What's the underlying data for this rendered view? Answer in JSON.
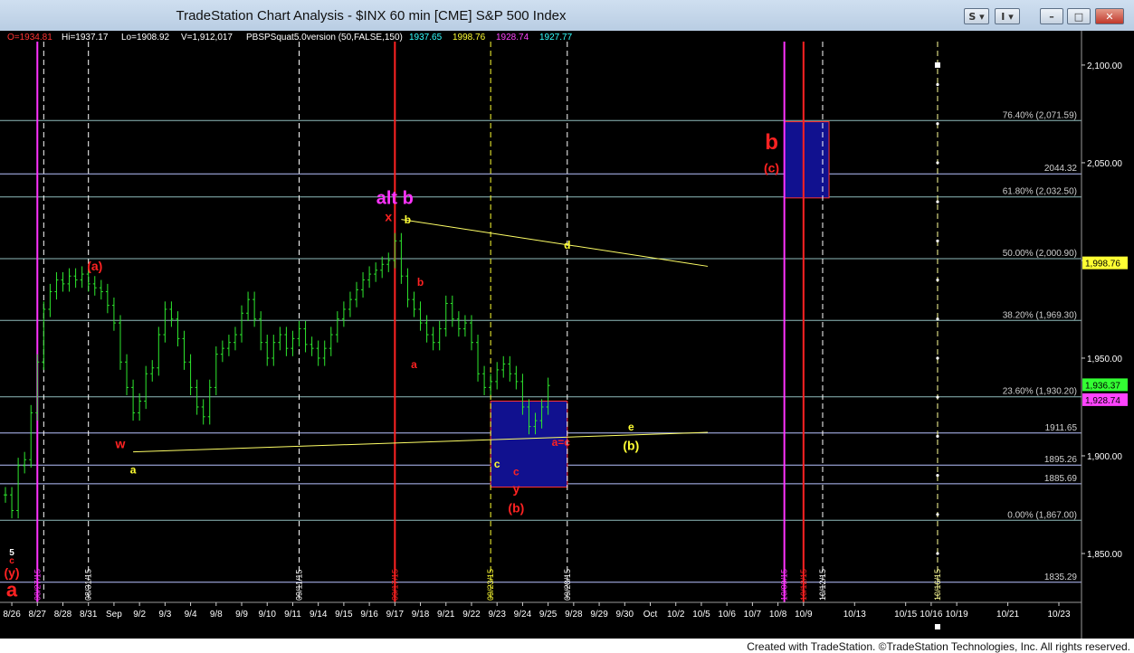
{
  "window": {
    "title": "TradeStation Chart Analysis - $INX 60 min [CME] S&P 500 Index",
    "buttons": [
      "S",
      "I",
      "–",
      "□",
      "✕"
    ]
  },
  "header": {
    "ohlc": [
      {
        "text": "O=1934.81",
        "color": "#ff3333"
      },
      {
        "text": "Hi=1937.17",
        "color": "#ffffff"
      },
      {
        "text": "Lo=1908.92",
        "color": "#ffffff"
      },
      {
        "text": "V=1,912,017",
        "color": "#ffffff"
      },
      {
        "text": "PBSPSquat5.0version (50,FALSE,150)",
        "color": "#ffffff"
      }
    ],
    "indicator_values": [
      {
        "text": "1937.65",
        "color": "#33ffff"
      },
      {
        "text": "1998.76",
        "color": "#ffff33"
      },
      {
        "text": "1928.74",
        "color": "#ff44ff"
      },
      {
        "text": "1927.77",
        "color": "#33ffff"
      }
    ]
  },
  "chart_data": {
    "type": "candlestick",
    "title": "TradeStation Chart Analysis - $INX 60 min [CME] S&P 500 Index",
    "symbol": "$INX",
    "interval": "60 min",
    "ylim": [
      1825,
      2112
    ],
    "x_range_index": [
      0,
      165
    ],
    "y_ticks": [
      1850.0,
      1900.0,
      1950.0,
      2000.0,
      2050.0,
      2100.0
    ],
    "y_tick_labels": [
      "1,850.00",
      "1,900.00",
      "1,950.00",
      "2,000.00",
      "2,050.00",
      "2,100.00"
    ],
    "x_tick_labels": [
      {
        "label": "8/26",
        "i": 1
      },
      {
        "label": "8/27",
        "i": 5
      },
      {
        "label": "8/28",
        "i": 9
      },
      {
        "label": "8/31",
        "i": 13
      },
      {
        "label": "Sep",
        "i": 17
      },
      {
        "label": "9/2",
        "i": 21
      },
      {
        "label": "9/3",
        "i": 25
      },
      {
        "label": "9/4",
        "i": 29
      },
      {
        "label": "9/8",
        "i": 33
      },
      {
        "label": "9/9",
        "i": 37
      },
      {
        "label": "9/10",
        "i": 41
      },
      {
        "label": "9/11",
        "i": 45
      },
      {
        "label": "9/14",
        "i": 49
      },
      {
        "label": "9/15",
        "i": 53
      },
      {
        "label": "9/16",
        "i": 57
      },
      {
        "label": "9/17",
        "i": 61
      },
      {
        "label": "9/18",
        "i": 65
      },
      {
        "label": "9/21",
        "i": 69
      },
      {
        "label": "9/22",
        "i": 73
      },
      {
        "label": "9/23",
        "i": 77
      },
      {
        "label": "9/24",
        "i": 81
      },
      {
        "label": "9/25",
        "i": 85
      },
      {
        "label": "9/28",
        "i": 89
      },
      {
        "label": "9/29",
        "i": 93
      },
      {
        "label": "9/30",
        "i": 97
      },
      {
        "label": "Oct",
        "i": 101
      },
      {
        "label": "10/2",
        "i": 105
      },
      {
        "label": "10/5",
        "i": 109
      },
      {
        "label": "10/6",
        "i": 113
      },
      {
        "label": "10/7",
        "i": 117
      },
      {
        "label": "10/8",
        "i": 121
      },
      {
        "label": "10/9",
        "i": 125
      },
      {
        "label": "10/13",
        "i": 133
      },
      {
        "label": "10/15",
        "i": 141
      },
      {
        "label": "10/16",
        "i": 145
      },
      {
        "label": "10/19",
        "i": 149
      },
      {
        "label": "10/21",
        "i": 157
      },
      {
        "label": "10/23",
        "i": 165
      }
    ],
    "close_path": [
      [
        0,
        1880
      ],
      [
        1,
        1872
      ],
      [
        2,
        1895
      ],
      [
        3,
        1898
      ],
      [
        4,
        1922
      ],
      [
        5,
        1948
      ],
      [
        6,
        1975
      ],
      [
        7,
        1984
      ],
      [
        8,
        1990
      ],
      [
        9,
        1988
      ],
      [
        10,
        1992
      ],
      [
        11,
        1990
      ],
      [
        12,
        1993
      ],
      [
        13,
        1988
      ],
      [
        14,
        1986
      ],
      [
        15,
        1984
      ],
      [
        16,
        1977
      ],
      [
        17,
        1968
      ],
      [
        18,
        1948
      ],
      [
        19,
        1935
      ],
      [
        20,
        1922
      ],
      [
        21,
        1928
      ],
      [
        22,
        1942
      ],
      [
        23,
        1945
      ],
      [
        24,
        1962
      ],
      [
        25,
        1975
      ],
      [
        26,
        1970
      ],
      [
        27,
        1960
      ],
      [
        28,
        1948
      ],
      [
        29,
        1935
      ],
      [
        30,
        1925
      ],
      [
        31,
        1920
      ],
      [
        32,
        1935
      ],
      [
        33,
        1952
      ],
      [
        34,
        1955
      ],
      [
        35,
        1958
      ],
      [
        36,
        1962
      ],
      [
        37,
        1973
      ],
      [
        38,
        1980
      ],
      [
        39,
        1970
      ],
      [
        40,
        1958
      ],
      [
        41,
        1950
      ],
      [
        42,
        1958
      ],
      [
        43,
        1962
      ],
      [
        44,
        1955
      ],
      [
        45,
        1960
      ],
      [
        46,
        1965
      ],
      [
        47,
        1957
      ],
      [
        48,
        1955
      ],
      [
        49,
        1950
      ],
      [
        50,
        1955
      ],
      [
        51,
        1962
      ],
      [
        52,
        1970
      ],
      [
        53,
        1975
      ],
      [
        54,
        1980
      ],
      [
        55,
        1985
      ],
      [
        56,
        1990
      ],
      [
        57,
        1993
      ],
      [
        58,
        1995
      ],
      [
        59,
        1998
      ],
      [
        60,
        2000
      ],
      [
        61,
        2010
      ],
      [
        62,
        1992
      ],
      [
        63,
        1980
      ],
      [
        64,
        1975
      ],
      [
        65,
        1968
      ],
      [
        66,
        1962
      ],
      [
        67,
        1958
      ],
      [
        68,
        1965
      ],
      [
        69,
        1978
      ],
      [
        70,
        1970
      ],
      [
        71,
        1965
      ],
      [
        72,
        1968
      ],
      [
        73,
        1958
      ],
      [
        74,
        1942
      ],
      [
        75,
        1935
      ],
      [
        76,
        1938
      ],
      [
        77,
        1944
      ],
      [
        78,
        1947
      ],
      [
        79,
        1942
      ],
      [
        80,
        1938
      ],
      [
        81,
        1925
      ],
      [
        82,
        1915
      ],
      [
        83,
        1918
      ],
      [
        84,
        1925
      ],
      [
        85,
        1936
      ]
    ],
    "annotations": {
      "red_wave_labels": [
        {
          "text": "(a)",
          "i": 14,
          "y": 1995,
          "color": "#ff2222",
          "size": 14
        },
        {
          "text": "x",
          "i": 60,
          "y": 2020,
          "color": "#ff2222",
          "size": 14
        },
        {
          "text": "b",
          "i": 65,
          "y": 1987,
          "color": "#ff2222",
          "size": 12
        },
        {
          "text": "a",
          "i": 64,
          "y": 1945,
          "color": "#ff2222",
          "size": 12
        },
        {
          "text": "w",
          "i": 18,
          "y": 1904,
          "color": "#ff2222",
          "size": 14
        },
        {
          "text": "c",
          "i": 80,
          "y": 1890,
          "color": "#ff2222",
          "size": 12
        },
        {
          "text": "y",
          "i": 80,
          "y": 1881,
          "color": "#ff2222",
          "size": 14
        },
        {
          "text": "(b)",
          "i": 80,
          "y": 1871,
          "color": "#ff2222",
          "size": 14
        },
        {
          "text": "a=c",
          "i": 87,
          "y": 1905,
          "color": "#ff2222",
          "size": 12
        },
        {
          "text": "(c)",
          "i": 120,
          "y": 2045,
          "color": "#ff2222",
          "size": 14
        },
        {
          "text": "b",
          "i": 120,
          "y": 2057,
          "color": "#ff2222",
          "size": 24
        },
        {
          "text": "5",
          "i": 1,
          "y": 1849,
          "color": "#ffffff",
          "size": 10
        },
        {
          "text": "c",
          "i": 1,
          "y": 1845,
          "color": "#ff2222",
          "size": 10
        },
        {
          "text": "(y)",
          "i": 1,
          "y": 1838,
          "color": "#ff2222",
          "size": 14
        },
        {
          "text": "a",
          "i": 1,
          "y": 1828,
          "color": "#ff2222",
          "size": 22
        }
      ],
      "yellow_wave_labels": [
        {
          "text": "b",
          "i": 63,
          "y": 2019,
          "color": "#ffff33",
          "size": 12
        },
        {
          "text": "d",
          "i": 88,
          "y": 2006,
          "color": "#ffff33",
          "size": 12
        },
        {
          "text": "a",
          "i": 20,
          "y": 1891,
          "color": "#ffff33",
          "size": 12
        },
        {
          "text": "c",
          "i": 77,
          "y": 1894,
          "color": "#ffff33",
          "size": 12
        },
        {
          "text": "e",
          "i": 98,
          "y": 1913,
          "color": "#ffff33",
          "size": 12
        },
        {
          "text": "(b)",
          "i": 98,
          "y": 1903,
          "color": "#ffff33",
          "size": 14
        }
      ],
      "magenta_labels": [
        {
          "text": "alt b",
          "i": 61,
          "y": 2029,
          "color": "#ff33ff",
          "size": 20
        }
      ],
      "fib_levels": [
        {
          "label": "76.40% (2,071.59)",
          "y": 2071.59
        },
        {
          "label": "61.80% (2,032.50)",
          "y": 2032.5
        },
        {
          "label": "50.00% (2,000.90)",
          "y": 2000.9
        },
        {
          "label": "38.20% (1,969.30)",
          "y": 1969.3
        },
        {
          "label": "23.60% (1,930.20)",
          "y": 1930.2
        },
        {
          "label": "0.00% (1,867.00)",
          "y": 1867.0
        }
      ],
      "price_lines": [
        {
          "label": "2044.32",
          "y": 2044.32
        },
        {
          "label": "1911.65",
          "y": 1911.65
        },
        {
          "label": "1895.26",
          "y": 1895.26
        },
        {
          "label": "1885.69",
          "y": 1885.69
        },
        {
          "label": "1835.29",
          "y": 1835.29
        }
      ],
      "right_markers": [
        {
          "label": "1,998.76",
          "y": 1998.76,
          "bg": "#ffff33",
          "color": "#000000"
        },
        {
          "label": "1,936.37",
          "y": 1936.37,
          "bg": "#33ff33",
          "color": "#000000"
        },
        {
          "label": "1,928.74",
          "y": 1928.74,
          "bg": "#ff44ff",
          "color": "#000000"
        }
      ],
      "vertical_date_lines": [
        {
          "label": "08/27/15",
          "i": 5,
          "color": "#ff33ff",
          "style": "solid"
        },
        {
          "label": "08/31/15",
          "i": 13,
          "color": "#ffffff",
          "style": "dash"
        },
        {
          "label": "09/11/15",
          "i": 46,
          "color": "#ffffff",
          "style": "dash"
        },
        {
          "label": "09/17/15",
          "i": 61,
          "color": "#ff2222",
          "style": "solid"
        },
        {
          "label": "09/23/15",
          "i": 76,
          "color": "#ffff33",
          "style": "dash"
        },
        {
          "label": "09/28/15",
          "i": 88,
          "color": "#ffffff",
          "style": "dash"
        },
        {
          "label": "10/09/15",
          "i": 122,
          "color": "#ff33ff",
          "style": "solid"
        },
        {
          "label": "10/12/15",
          "i": 125,
          "color": "#ff2222",
          "style": "solid"
        },
        {
          "label": "10/12/15",
          "i": 128,
          "color": "#ffffff",
          "style": "dash"
        },
        {
          "label": "10/16/15",
          "i": 146,
          "color": "#ffff99",
          "style": "dash"
        }
      ],
      "extra_dashed_lines": [
        {
          "i": 6
        }
      ],
      "boxes": [
        {
          "i0": 76,
          "i1": 88,
          "y0": 1884,
          "y1": 1928,
          "fill": "#11118f",
          "stroke": "#ff3333"
        },
        {
          "i0": 122,
          "i1": 129,
          "y0": 2032,
          "y1": 2071,
          "fill": "#11118f",
          "stroke": "#ff3333"
        }
      ],
      "trendlines": [
        {
          "i0": 62,
          "y0": 2021,
          "i1": 110,
          "y1": 1997,
          "color": "#ffff66"
        },
        {
          "i0": 20,
          "y0": 1902,
          "i1": 110,
          "y1": 1912,
          "color": "#ffff66"
        }
      ]
    }
  },
  "footer": {
    "text": "Created with TradeStation. ©TradeStation Technologies, Inc. All rights reserved."
  }
}
